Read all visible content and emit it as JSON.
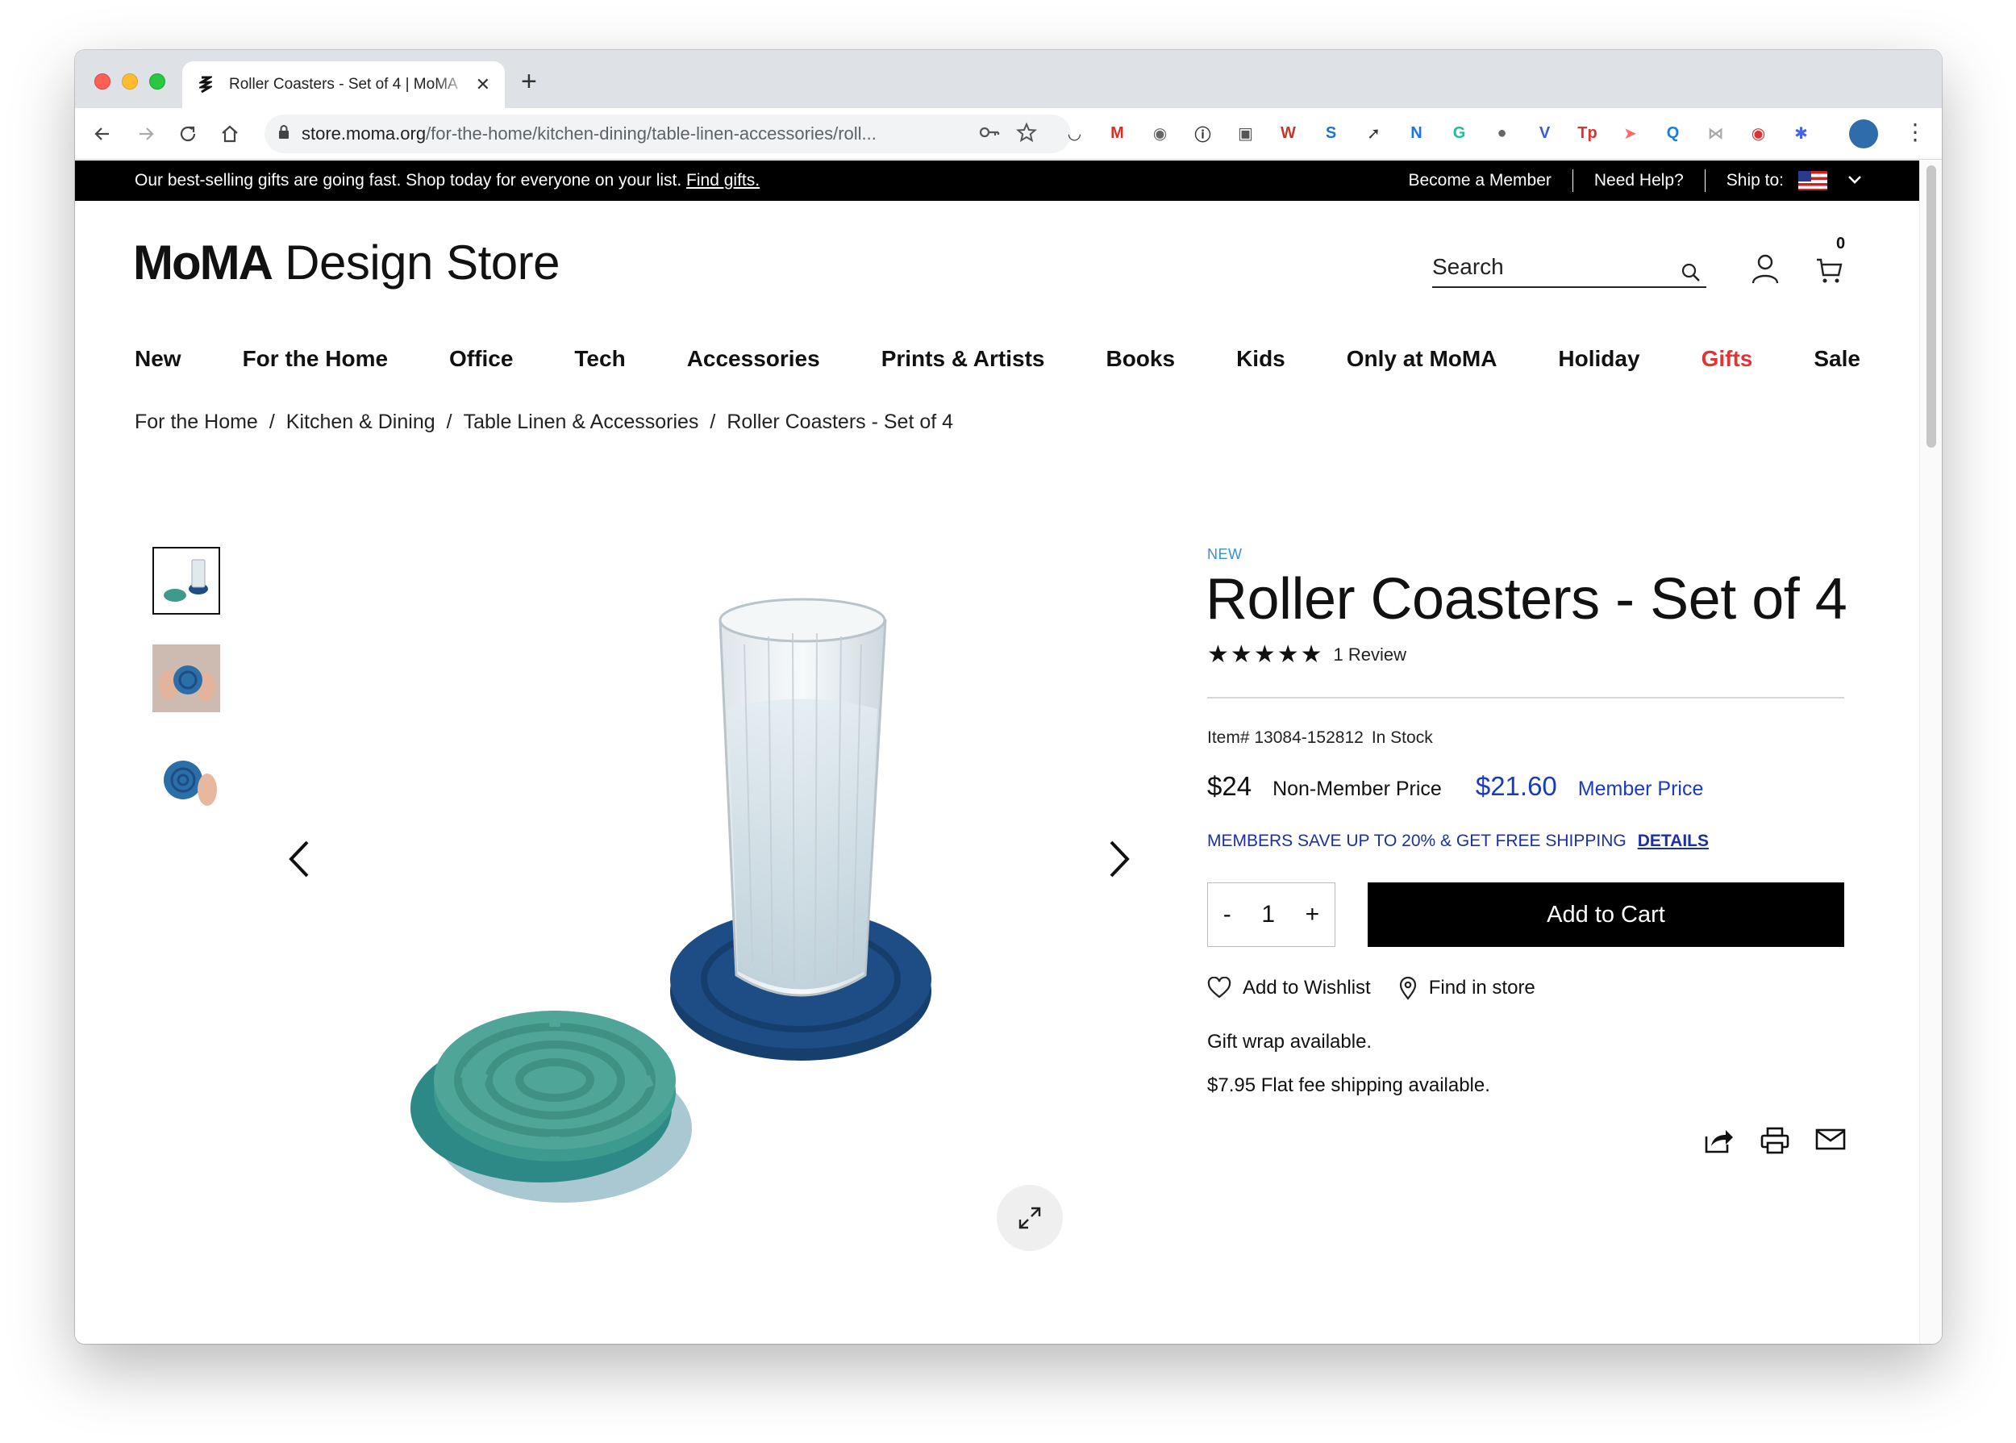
{
  "browser": {
    "tab_title": "Roller Coasters - Set of 4 | MoMA",
    "url_host": "store.moma.org",
    "url_path": "/for-the-home/kitchen-dining/table-linen-accessories/roll...",
    "extensions": [
      {
        "name": "pocket-icon",
        "glyph": "◡",
        "color": "#333333"
      },
      {
        "name": "gmail-icon",
        "glyph": "M",
        "color": "#d93025"
      },
      {
        "name": "camera-icon",
        "glyph": "◉",
        "color": "#666666"
      },
      {
        "name": "onepassword-icon",
        "glyph": "ⓘ",
        "color": "#333333"
      },
      {
        "name": "screenshot-icon",
        "glyph": "▣",
        "color": "#555555"
      },
      {
        "name": "w-icon",
        "glyph": "W",
        "color": "#c0392b"
      },
      {
        "name": "s-icon",
        "glyph": "S",
        "color": "#1a73e8"
      },
      {
        "name": "rocket-icon",
        "glyph": "➚",
        "color": "#333333"
      },
      {
        "name": "new-badge-icon",
        "glyph": "N",
        "color": "#1a73e8"
      },
      {
        "name": "grammarly-icon",
        "glyph": "G",
        "color": "#15c39a"
      },
      {
        "name": "circle-icon",
        "glyph": "●",
        "color": "#666666"
      },
      {
        "name": "v-icon",
        "glyph": "V",
        "color": "#3b5bdb"
      },
      {
        "name": "tp-icon",
        "glyph": "Tp",
        "color": "#e03131"
      },
      {
        "name": "arrow-ext-icon",
        "glyph": "➤",
        "color": "#ff6b6b"
      },
      {
        "name": "q-icon",
        "glyph": "Q",
        "color": "#1c7ed6"
      },
      {
        "name": "butterfly-icon",
        "glyph": "⋈",
        "color": "#aaaaaa"
      },
      {
        "name": "record-icon",
        "glyph": "◉",
        "color": "#e03131"
      },
      {
        "name": "puzzle-icon",
        "glyph": "✱",
        "color": "#4263eb"
      }
    ]
  },
  "promo": {
    "text": "Our best-selling gifts are going fast. Shop today for everyone on your list.",
    "link": "Find gifts.",
    "become_member": "Become a Member",
    "need_help": "Need Help?",
    "ship_to": "Ship to:"
  },
  "header": {
    "logo_bold": "MoMA",
    "logo_light": "Design Store",
    "search_placeholder": "Search",
    "cart_count": "0"
  },
  "nav": [
    "New",
    "For the Home",
    "Office",
    "Tech",
    "Accessories",
    "Prints & Artists",
    "Books",
    "Kids",
    "Only at MoMA",
    "Holiday",
    "Gifts",
    "Sale"
  ],
  "breadcrumb": [
    "For the Home",
    "Kitchen & Dining",
    "Table Linen & Accessories",
    "Roller Coasters - Set of 4"
  ],
  "product": {
    "badge": "NEW",
    "title": "Roller Coasters - Set of 4",
    "rating": 5,
    "reviews": "1 Review",
    "item_number": "Item# 13084-152812",
    "stock": "In Stock",
    "price": "$24",
    "price_label": "Non-Member Price",
    "member_price": "$21.60",
    "member_label": "Member Price",
    "member_promo": "MEMBERS SAVE UP TO 20% & GET FREE SHIPPING",
    "details": "DETAILS",
    "qty_minus": "-",
    "qty_value": "1",
    "qty_plus": "+",
    "add_to_cart": "Add to Cart",
    "wishlist": "Add to Wishlist",
    "find_store": "Find in store",
    "gift_wrap": "Gift wrap available.",
    "shipping": "$7.95 Flat fee shipping available."
  },
  "colors": {
    "accent_blue": "#1a3bbf",
    "gifts_red": "#e63232",
    "teal_coaster": "#4fa597",
    "navy_coaster": "#1d4d84"
  }
}
